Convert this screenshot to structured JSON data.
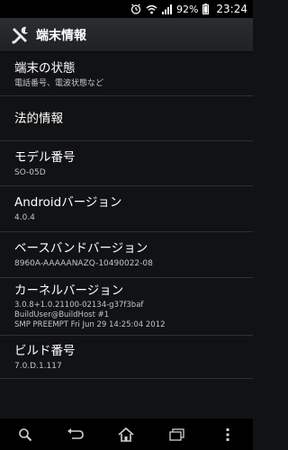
{
  "status_bar": {
    "battery": "92%",
    "time": "23:24",
    "icons": [
      "alarm-icon",
      "wifi-icon",
      "signal-icon",
      "battery-icon"
    ]
  },
  "action_bar": {
    "title": "端末情報",
    "icon": "tools-icon"
  },
  "items": [
    {
      "title": "端末の状態",
      "subtitle": "電話番号、電波状態など"
    },
    {
      "title": "法的情報"
    },
    {
      "title": "モデル番号",
      "subtitle": "SO-05D"
    },
    {
      "title": "Androidバージョン",
      "subtitle": "4.0.4"
    },
    {
      "title": "ベースバンドバージョン",
      "subtitle": "8960A-AAAAANAZQ-10490022-08"
    },
    {
      "title": "カーネルバージョン",
      "subtitle": "3.0.8+1.0.21100-02134-g37f3baf\nBuildUser@BuildHost #1\nSMP PREEMPT Fri Jun 29 14:25:04 2012"
    },
    {
      "title": "ビルド番号",
      "subtitle": "7.0.D.1.117"
    }
  ],
  "nav_bar": {
    "buttons": [
      "search-icon",
      "back-icon",
      "home-icon",
      "recent-apps-icon",
      "menu-icon"
    ]
  }
}
